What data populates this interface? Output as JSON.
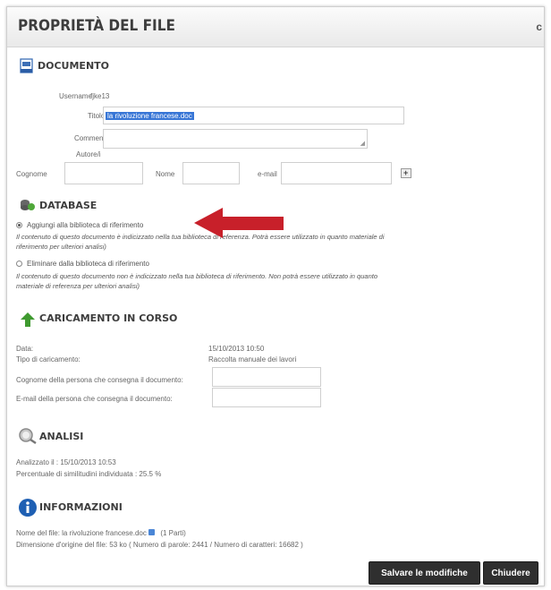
{
  "dialog": {
    "title": "PROPRIETÀ DEL FILE",
    "close_glyph": "c"
  },
  "documento": {
    "section_title": "DOCUMENTO",
    "username_label": "Username",
    "username_value": "fjke13",
    "titolo_label": "Titolo",
    "titolo_value": "la rivoluzione francese.doc",
    "commenti_label": "Commenti",
    "autore_label": "Autore/i",
    "cognome_label": "Cognome",
    "nome_label": "Nome",
    "email_label": "e-mail",
    "add_glyph": "+"
  },
  "database": {
    "section_title": "DATABASE",
    "option1_label": "Aggiungi alla biblioteca di riferimento",
    "option1_desc_line1": "Il contenuto di questo documento è indicizzato nella tua biblioteca di referenza. Potrà essere utilizzato in quanto materiale di",
    "option1_desc_line2": "riferimento per ulteriori analisi)",
    "option2_label": "Eliminare dalla biblioteca di riferimento",
    "option2_desc_line1": "Il contenuto di questo documento non è indicizzato nella tua biblioteca di riferimento. Non potrà essere utilizzato in quanto",
    "option2_desc_line2": "materiale di referenza per ulteriori analisi)"
  },
  "caricamento": {
    "section_title": "CARICAMENTO IN CORSO",
    "data_label": "Data:",
    "data_value": "15/10/2013 10:50",
    "tipo_label": "Tipo di caricamento:",
    "tipo_value": "Raccolta manuale dei lavori",
    "cognome_label": "Cognome della persona che consegna il documento:",
    "email_label": "E-mail della persona che consegna il documento:"
  },
  "analisi": {
    "section_title": "ANALISI",
    "analizzato": "Analizzato il : 15/10/2013 10:53",
    "percentuale": "Percentuale di similitudini individuata : 25.5 %"
  },
  "informazioni": {
    "section_title": "INFORMAZIONI",
    "nome_file_prefix": "Nome del file: la rivoluzione francese.doc",
    "parti": "(1 Parti)",
    "dimensione": "Dimensione d'origine del file: 53 ko ( Numero di parole: 2441 / Numero di caratteri: 16682 )"
  },
  "footer": {
    "save_label": "Salvare le modifiche",
    "close_label": "Chiudere"
  },
  "colors": {
    "arrow": "#c8202a",
    "button_bg": "#2f2f2f",
    "selection": "#3876d6"
  }
}
